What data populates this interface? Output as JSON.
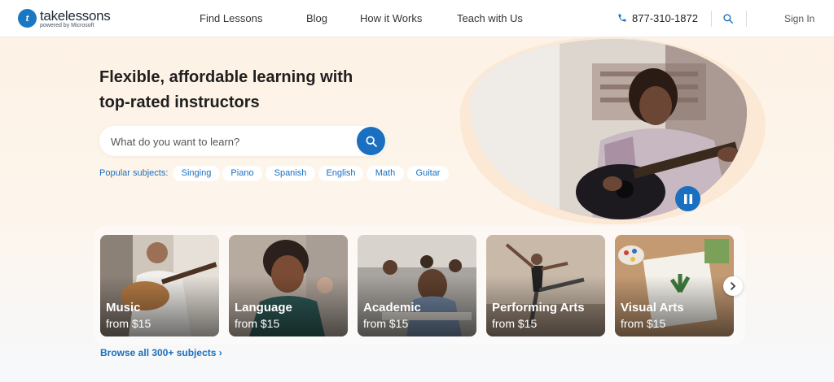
{
  "header": {
    "logo_mark": "t",
    "logo_text": "takelessons",
    "logo_sub": "powered by Microsoft",
    "nav": [
      "Find Lessons",
      "Blog",
      "How it Works",
      "Teach with Us"
    ],
    "phone": "877-310-1872",
    "signin": "Sign In"
  },
  "hero": {
    "title_line1": "Flexible, affordable learning with",
    "title_line2": "top-rated instructors",
    "search_placeholder": "What do you want to learn?",
    "popular_label": "Popular subjects:",
    "chips": [
      "Singing",
      "Piano",
      "Spanish",
      "English",
      "Math",
      "Guitar"
    ]
  },
  "cards": [
    {
      "title": "Music",
      "price": "from $15"
    },
    {
      "title": "Language",
      "price": "from $15"
    },
    {
      "title": "Academic",
      "price": "from $15"
    },
    {
      "title": "Performing Arts",
      "price": "from $15"
    },
    {
      "title": "Visual Arts",
      "price": "from $15"
    }
  ],
  "browse": "Browse all 300+ subjects ›",
  "colors": {
    "brand": "#1a6fc0",
    "background": "#fdf1e3"
  },
  "icons": {
    "phone": "phone-icon",
    "search": "search-icon",
    "pause": "pause-icon",
    "next": "chevron-right-icon"
  }
}
